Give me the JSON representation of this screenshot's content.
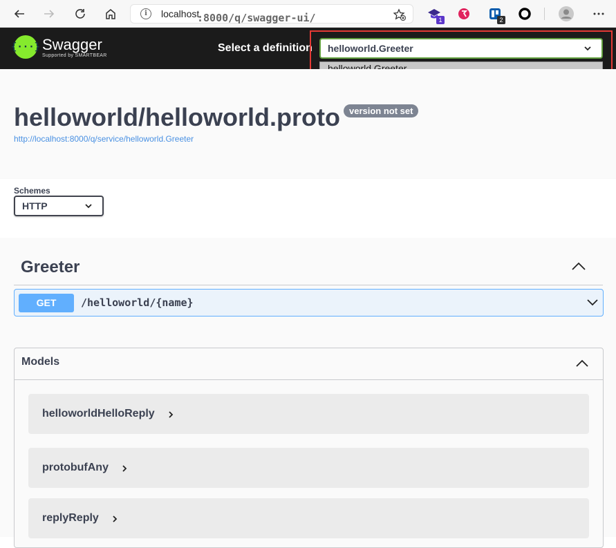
{
  "browser": {
    "url_host": "localhost",
    "url_path": ":8000/q/swagger-ui/",
    "ext_badges": [
      "1",
      "2"
    ]
  },
  "topbar": {
    "logo_name": "Swagger",
    "logo_sub": "Supported by SMARTBEAR",
    "definition_label": "Select a definition",
    "definition_value": "helloworld.Greeter",
    "definition_options": [
      "helloworld.Greeter"
    ]
  },
  "info": {
    "title": "helloworld/helloworld.proto",
    "version": "version not set",
    "base_url": "http://localhost:8000/q/service/helloworld.Greeter"
  },
  "schemes": {
    "label": "Schemes",
    "value": "HTTP"
  },
  "tag": {
    "name": "Greeter"
  },
  "operation": {
    "method": "GET",
    "path": "/helloworld/{name}"
  },
  "models": {
    "title": "Models",
    "items": [
      "helloworldHelloReply",
      "protobufAny",
      "replyReply"
    ]
  }
}
